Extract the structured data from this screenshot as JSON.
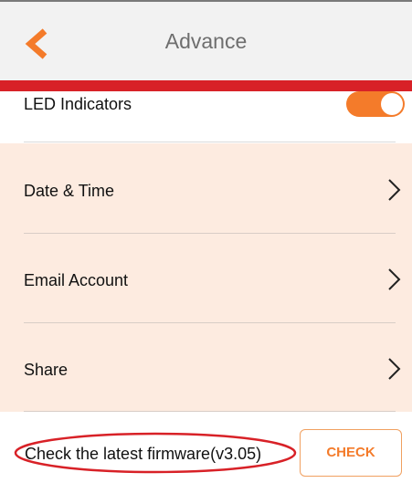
{
  "header": {
    "title": "Advance",
    "back_icon": "chevron-left-icon",
    "accent_color": "#f47b2a",
    "bar_color": "#d82127"
  },
  "led": {
    "label": "LED Indicators",
    "enabled": true
  },
  "settings": {
    "items": [
      {
        "label": "Date & Time"
      },
      {
        "label": "Email Account"
      },
      {
        "label": "Share"
      }
    ],
    "background": "#fdebe0"
  },
  "firmware": {
    "text": "Check the latest firmware(v3.05)",
    "check_label": "CHECK",
    "highlight_color": "#d82127"
  }
}
